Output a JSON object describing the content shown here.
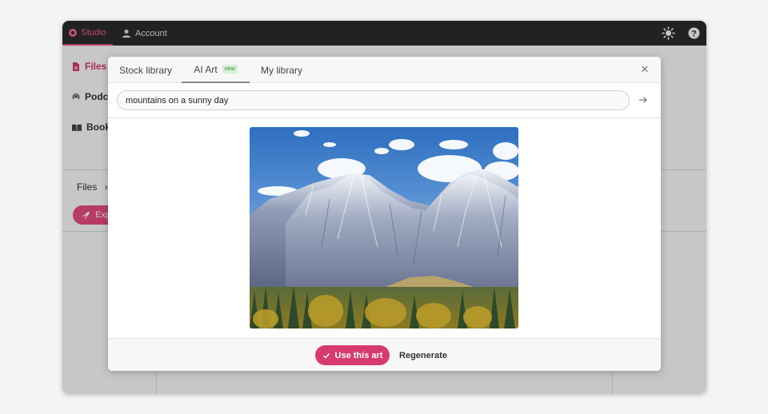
{
  "topbar": {
    "studio_label": "Studio",
    "account_label": "Account",
    "theme_icon": "sun-icon",
    "help_icon": "help-icon",
    "accent": "#e94c82"
  },
  "sidebar": {
    "items": [
      {
        "label": "Files",
        "icon": "file-icon"
      },
      {
        "label": "Podc",
        "icon": "podcast-icon"
      },
      {
        "label": "Book",
        "icon": "book-icon"
      }
    ],
    "breadcrumb": "Files",
    "breadcrumb_sep": "›",
    "explore_label": "Exp"
  },
  "modal": {
    "tabs": [
      {
        "label": "Stock library"
      },
      {
        "label": "AI Art",
        "badge": "new"
      },
      {
        "label": "My library"
      }
    ],
    "close_icon": "close-icon",
    "search": {
      "value": "mountains on a sunny day",
      "go_icon": "arrow-right-icon"
    },
    "image_description_icon": "generated-art-image",
    "footer": {
      "use_label": "Use this art",
      "use_icon": "check-icon",
      "regenerate_label": "Regenerate"
    }
  },
  "colors": {
    "primary": "#d63a6f",
    "topbar_bg": "#2c2c2c"
  }
}
